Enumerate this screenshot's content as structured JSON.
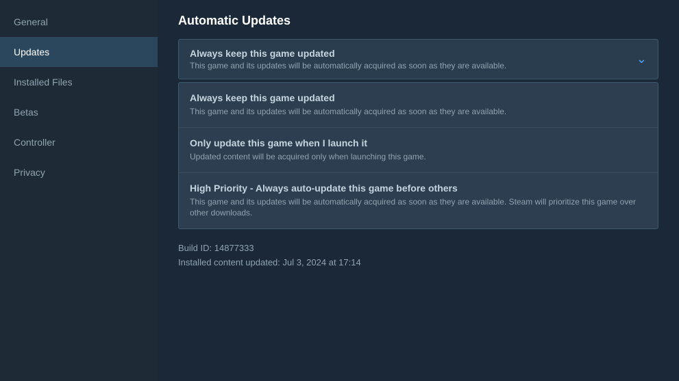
{
  "sidebar": {
    "items": [
      {
        "id": "general",
        "label": "General",
        "active": false
      },
      {
        "id": "updates",
        "label": "Updates",
        "active": true
      },
      {
        "id": "installed-files",
        "label": "Installed Files",
        "active": false
      },
      {
        "id": "betas",
        "label": "Betas",
        "active": false
      },
      {
        "id": "controller",
        "label": "Controller",
        "active": false
      },
      {
        "id": "privacy",
        "label": "Privacy",
        "active": false
      }
    ]
  },
  "main": {
    "section_title": "Automatic Updates",
    "dropdown_trigger": {
      "title": "Always keep this game updated",
      "description": "This game and its updates will be automatically acquired as soon as they are available."
    },
    "dropdown_options": [
      {
        "title": "Always keep this game updated",
        "description": "This game and its updates will be automatically acquired as soon as they are available."
      },
      {
        "title": "Only update this game when I launch it",
        "description": "Updated content will be acquired only when launching this game."
      },
      {
        "title": "High Priority - Always auto-update this game before others",
        "description": "This game and its updates will be automatically acquired as soon as they are available. Steam will prioritize this game over other downloads."
      }
    ],
    "build_id_label": "Build ID: 14877333",
    "installed_content_label": "Installed content updated: Jul 3, 2024 at 17:14"
  },
  "icons": {
    "chevron_down": "⌵"
  }
}
